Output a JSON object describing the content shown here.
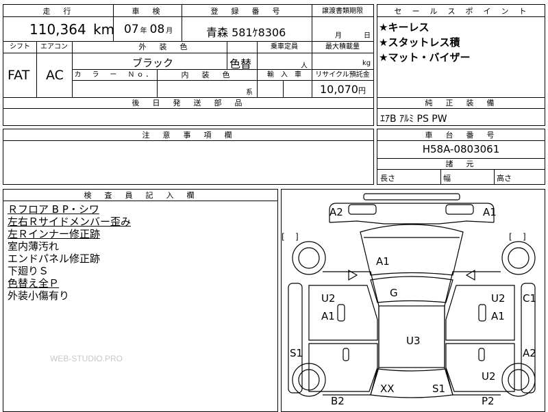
{
  "top_table": {
    "headers": {
      "mileage": "走　行",
      "inspection": "車　検",
      "registration": "登　録　番　号",
      "transfer_deadline": "譲渡書類期限"
    },
    "mileage_value": "110,364",
    "mileage_unit": "km",
    "inspection_year": "07",
    "inspection_year_unit": "年",
    "inspection_month": "08",
    "inspection_month_unit": "月",
    "registration_value": "青森 581ｹ8306",
    "deadline_month_unit": "月",
    "deadline_day_unit": "日",
    "row2_headers": {
      "shift": "シフト",
      "aircon": "エアコン",
      "exterior_color": "外　装　色",
      "capacity": "乗車定員",
      "max_load": "最大積載量"
    },
    "shift_value": "FAT",
    "aircon_value": "AC",
    "exterior_color_value": "ブラック",
    "repaint_label": "色替",
    "capacity_unit": "人",
    "max_load_unit": "kg",
    "row3_headers": {
      "color_no": "カ　ラ　ー　Ｎｏ．",
      "interior_color": "内　装　色",
      "import": "輸　入　車",
      "recycle": "リサイクル預託金"
    },
    "interior_color_unit": "系",
    "recycle_value": "10,070",
    "recycle_unit": "円",
    "later_parts_header": "後　日　発　送　部　品"
  },
  "sales_points": {
    "header": "セ　ー　ル　ス　ポ　イ　ン　ト",
    "items": [
      "★キーレス",
      "★スタットレス積",
      "★マット・バイザー"
    ]
  },
  "genuine_equipment": {
    "header": "純　正　装　備",
    "value": "ｴｱB ｱﾙﾐ PS PW"
  },
  "cautions": {
    "header": "注　意　事　項　欄"
  },
  "chassis": {
    "header": "車　台　番　号",
    "value": "H58A-0803061"
  },
  "dimensions": {
    "header": "諸　元",
    "length": "長さ",
    "width": "幅",
    "height": "高さ"
  },
  "inspector": {
    "header": "検　査　員　記　入　欄",
    "notes": [
      {
        "text": "Ｒフロア B P・シワ",
        "underline": true
      },
      {
        "text": "左右Ｒサイドメンバー歪み",
        "underline": true
      },
      {
        "text": "左Ｒインナー修正跡",
        "underline": true
      },
      {
        "text": "室内薄汚れ",
        "underline": false
      },
      {
        "text": "エンドパネル修正跡",
        "underline": false
      },
      {
        "text": "下廻りＳ",
        "underline": false
      },
      {
        "text": "色替え全Ｐ",
        "underline": true
      },
      {
        "text": "外装小傷有り",
        "underline": false
      }
    ],
    "watermark": "WEB-STUDIO.PRO"
  },
  "diagram": {
    "labels": {
      "front_left_corner": "A2",
      "front_right_corner": "A1",
      "hood": "A1",
      "windshield": "G",
      "left_front_door_top": "U2",
      "left_front_door_bottom": "A1",
      "right_front_door_top": "U2",
      "right_front_door_bottom": "A1",
      "right_fender": "C1",
      "roof": "U3",
      "left_sill": "S1",
      "right_rear": "A2",
      "right_rear_door": "U2",
      "rear_window": "XX",
      "trunk": "S1",
      "rear_left": "B2",
      "rear_right": "P2"
    },
    "bracket_left": "[    ]",
    "bracket_right": "[    ]"
  }
}
